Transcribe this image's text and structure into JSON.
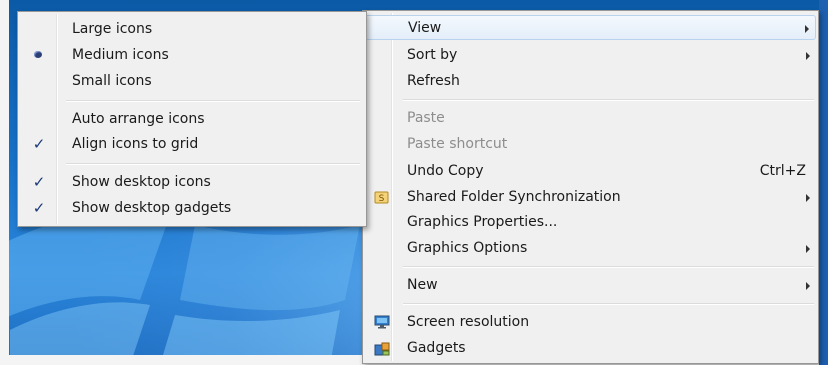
{
  "colors": {
    "menu_bg": "#f0f0f0",
    "highlight": "#e4eef9",
    "disabled_text": "#8d8d8d",
    "desktop_blue": "#1771c8"
  },
  "context_menu": {
    "items": [
      {
        "label": "View",
        "submenu": true,
        "highlighted": true
      },
      {
        "label": "Sort by",
        "submenu": true
      },
      {
        "label": "Refresh"
      },
      {
        "label": "Paste",
        "disabled": true
      },
      {
        "label": "Paste shortcut",
        "disabled": true
      },
      {
        "label": "Undo Copy",
        "shortcut": "Ctrl+Z"
      },
      {
        "label": "Shared Folder Synchronization",
        "submenu": true,
        "icon": "sync-folder-icon"
      },
      {
        "label": "Graphics Properties..."
      },
      {
        "label": "Graphics Options",
        "submenu": true
      },
      {
        "label": "New",
        "submenu": true
      },
      {
        "label": "Screen resolution",
        "icon": "screen-resolution-icon"
      },
      {
        "label": "Gadgets",
        "icon": "gadgets-icon"
      }
    ]
  },
  "view_submenu": {
    "items": [
      {
        "label": "Large icons"
      },
      {
        "label": "Medium icons",
        "mark": "bullet"
      },
      {
        "label": "Small icons"
      },
      {
        "label": "Auto arrange icons"
      },
      {
        "label": "Align icons to grid",
        "mark": "check"
      },
      {
        "label": "Show desktop icons",
        "mark": "check"
      },
      {
        "label": "Show desktop gadgets",
        "mark": "check"
      }
    ]
  }
}
